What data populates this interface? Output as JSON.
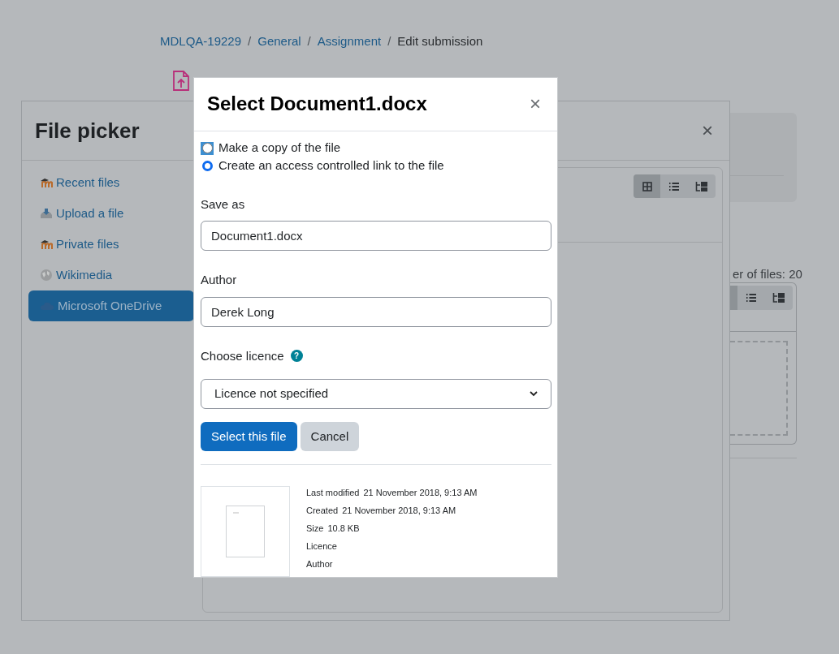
{
  "breadcrumb": [
    {
      "label": "MDLQA-19229",
      "kind": "link"
    },
    {
      "label": "/",
      "kind": "separator"
    },
    {
      "label": "General",
      "kind": "link"
    },
    {
      "label": "/",
      "kind": "separator"
    },
    {
      "label": "Assignment",
      "kind": "link"
    },
    {
      "label": "/",
      "kind": "separator"
    },
    {
      "label": "Edit submission",
      "kind": "current"
    }
  ],
  "background_page": {
    "files_count": "er of files: 20"
  },
  "file_picker": {
    "title": "File picker",
    "close": "×",
    "repositories": [
      {
        "label": "Recent files",
        "kind": "moodle",
        "selected": false
      },
      {
        "label": "Upload a file",
        "kind": "upload",
        "selected": false
      },
      {
        "label": "Private files",
        "kind": "moodle",
        "selected": false
      },
      {
        "label": "Wikimedia",
        "kind": "wikimedia",
        "selected": false
      },
      {
        "label": "Microsoft OneDrive",
        "kind": "onedrive",
        "selected": true
      }
    ],
    "views": [
      {
        "kind": "grid",
        "selected": true
      },
      {
        "kind": "list",
        "selected": false
      },
      {
        "kind": "tree",
        "selected": false
      }
    ]
  },
  "dialog": {
    "title": "Select Document1.docx",
    "close": "×",
    "options": [
      {
        "label": "Make a copy of the file",
        "selected": false,
        "focused": true
      },
      {
        "label": "Create an access controlled link to the file",
        "selected": true,
        "focused": false
      }
    ],
    "fields": [
      {
        "label": "Save as",
        "value": "Document1.docx"
      },
      {
        "label": "Author",
        "value": "Derek Long"
      }
    ],
    "licence": {
      "label": "Choose licence",
      "help": "?",
      "value": "Licence not specified"
    },
    "buttons": [
      {
        "label": "Select this file",
        "kind": "primary"
      },
      {
        "label": "Cancel",
        "kind": "secondary"
      }
    ],
    "details": [
      {
        "label": "Last modified",
        "value": "21 November 2018, 9:13 AM"
      },
      {
        "label": "Created",
        "value": "21 November 2018, 9:13 AM"
      },
      {
        "label": "Size",
        "value": "10.8 KB"
      },
      {
        "label": "Licence"
      },
      {
        "label": "Author"
      }
    ]
  }
}
